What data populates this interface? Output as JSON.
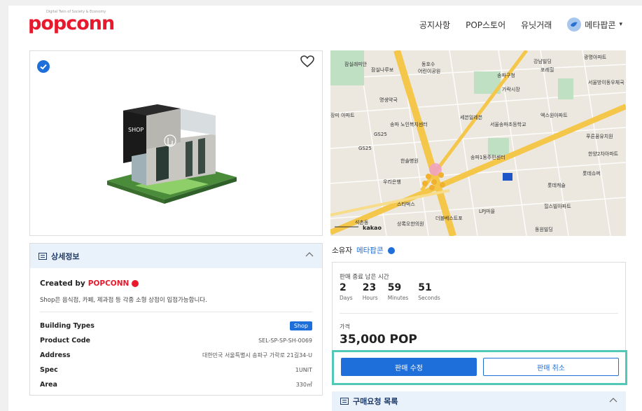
{
  "header": {
    "logo_tagline": "Digital Twin of Society & Economy",
    "logo_text": "popconn",
    "nav": [
      "공지사항",
      "POP스토어",
      "유닛거래"
    ],
    "user_name": "메타팝콘",
    "caret": "▾"
  },
  "viewer": {
    "shop_sign": "SHOP",
    "verified_icon": "check-badge-icon",
    "favorite_icon": "heart-icon"
  },
  "map": {
    "labels": [
      "잠실래미안",
      "잠실나루보",
      "동호수",
      "어린이공원",
      "송파구청",
      "가락시장",
      "송파1동주민센터",
      "GS25",
      "GS25",
      "한솔병원",
      "우리은행",
      "스타벅스",
      "석촌동",
      "상록오한의원",
      "더블베스트포",
      "LPJ마을",
      "동원빌딩",
      "롯데슈퍼",
      "힐스빌아파트",
      "송파 노인복지센터",
      "서울송파초등학교",
      "엑스원아파트",
      "푸른꿈유치원",
      "장미 아파트",
      "광명아파트",
      "명생약국",
      "세븐일레븐",
      "강남빌딩",
      "포레힐",
      "서울방이동우체국",
      "한양2차아파트",
      "롯데캐슬"
    ],
    "attribution": "kakao"
  },
  "detail": {
    "title": "상세정보",
    "created_by_label": "Created by",
    "created_by_brand": "POPCONN",
    "description": "Shop은 음식점, 카페, 제과점 등 각종 소형 상점이 입점가능합니다.",
    "rows": [
      {
        "key": "Building Types",
        "value": "Shop"
      },
      {
        "key": "Product Code",
        "value": "SEL-SP-SP-SH-0069"
      },
      {
        "key": "Address",
        "value": "대한민국 서울특별시 송파구 가락로 21길34-U"
      },
      {
        "key": "Spec",
        "value": "1UNIT"
      },
      {
        "key": "Area",
        "value": "330㎡"
      }
    ]
  },
  "owner": {
    "label": "소유자",
    "name": "메타팝콘"
  },
  "sale": {
    "remain_label": "판매 종료 남은 시간",
    "timer": [
      {
        "value": "2",
        "unit": "Days"
      },
      {
        "value": "23",
        "unit": "Hours"
      },
      {
        "value": "59",
        "unit": "Minutes"
      },
      {
        "value": "51",
        "unit": "Seconds"
      }
    ],
    "price_label": "가격",
    "price": "35,000 POP",
    "edit_button": "판매 수정",
    "cancel_button": "판매 취소",
    "accent": "#1e6fd9",
    "highlight": "#52c9b6"
  },
  "purchase": {
    "title": "구매요청 목록"
  }
}
